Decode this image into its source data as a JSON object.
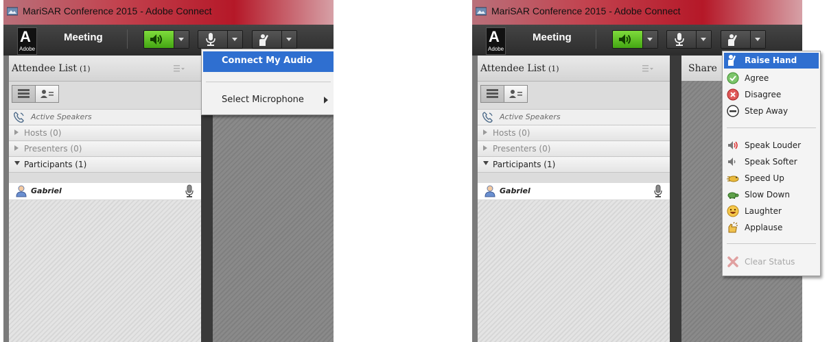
{
  "window": {
    "title": "MariSAR Conference 2015 - Adobe Connect"
  },
  "toolbar": {
    "logo_label": "Adobe",
    "meeting_menu": "Meeting"
  },
  "attendee_panel": {
    "title": "Attendee List",
    "count": "(1)",
    "active_speakers_label": "Active Speakers",
    "sections": {
      "hosts": "Hosts (0)",
      "presenters": "Presenters (0)",
      "participants": "Participants (1)"
    },
    "participants": [
      {
        "name": "Gabriel"
      }
    ]
  },
  "share_pod": {
    "title": "Share"
  },
  "mic_menu": {
    "items": [
      "Connect My Audio",
      "Select Microphone"
    ]
  },
  "status_menu": {
    "items": [
      {
        "label": "Raise Hand",
        "icon": "raise-hand-icon"
      },
      {
        "label": "Agree",
        "icon": "agree-icon"
      },
      {
        "label": "Disagree",
        "icon": "disagree-icon"
      },
      {
        "label": "Step Away",
        "icon": "step-away-icon"
      },
      {
        "label": "Speak Louder",
        "icon": "speak-louder-icon"
      },
      {
        "label": "Speak Softer",
        "icon": "speak-softer-icon"
      },
      {
        "label": "Speed Up",
        "icon": "speed-up-icon"
      },
      {
        "label": "Slow Down",
        "icon": "slow-down-icon"
      },
      {
        "label": "Laughter",
        "icon": "laughter-icon"
      },
      {
        "label": "Applause",
        "icon": "applause-icon"
      },
      {
        "label": "Clear Status",
        "icon": "clear-status-icon"
      }
    ]
  },
  "colors": {
    "menu_highlight": "#2f6fd0",
    "speaker_active": "#44a613"
  }
}
